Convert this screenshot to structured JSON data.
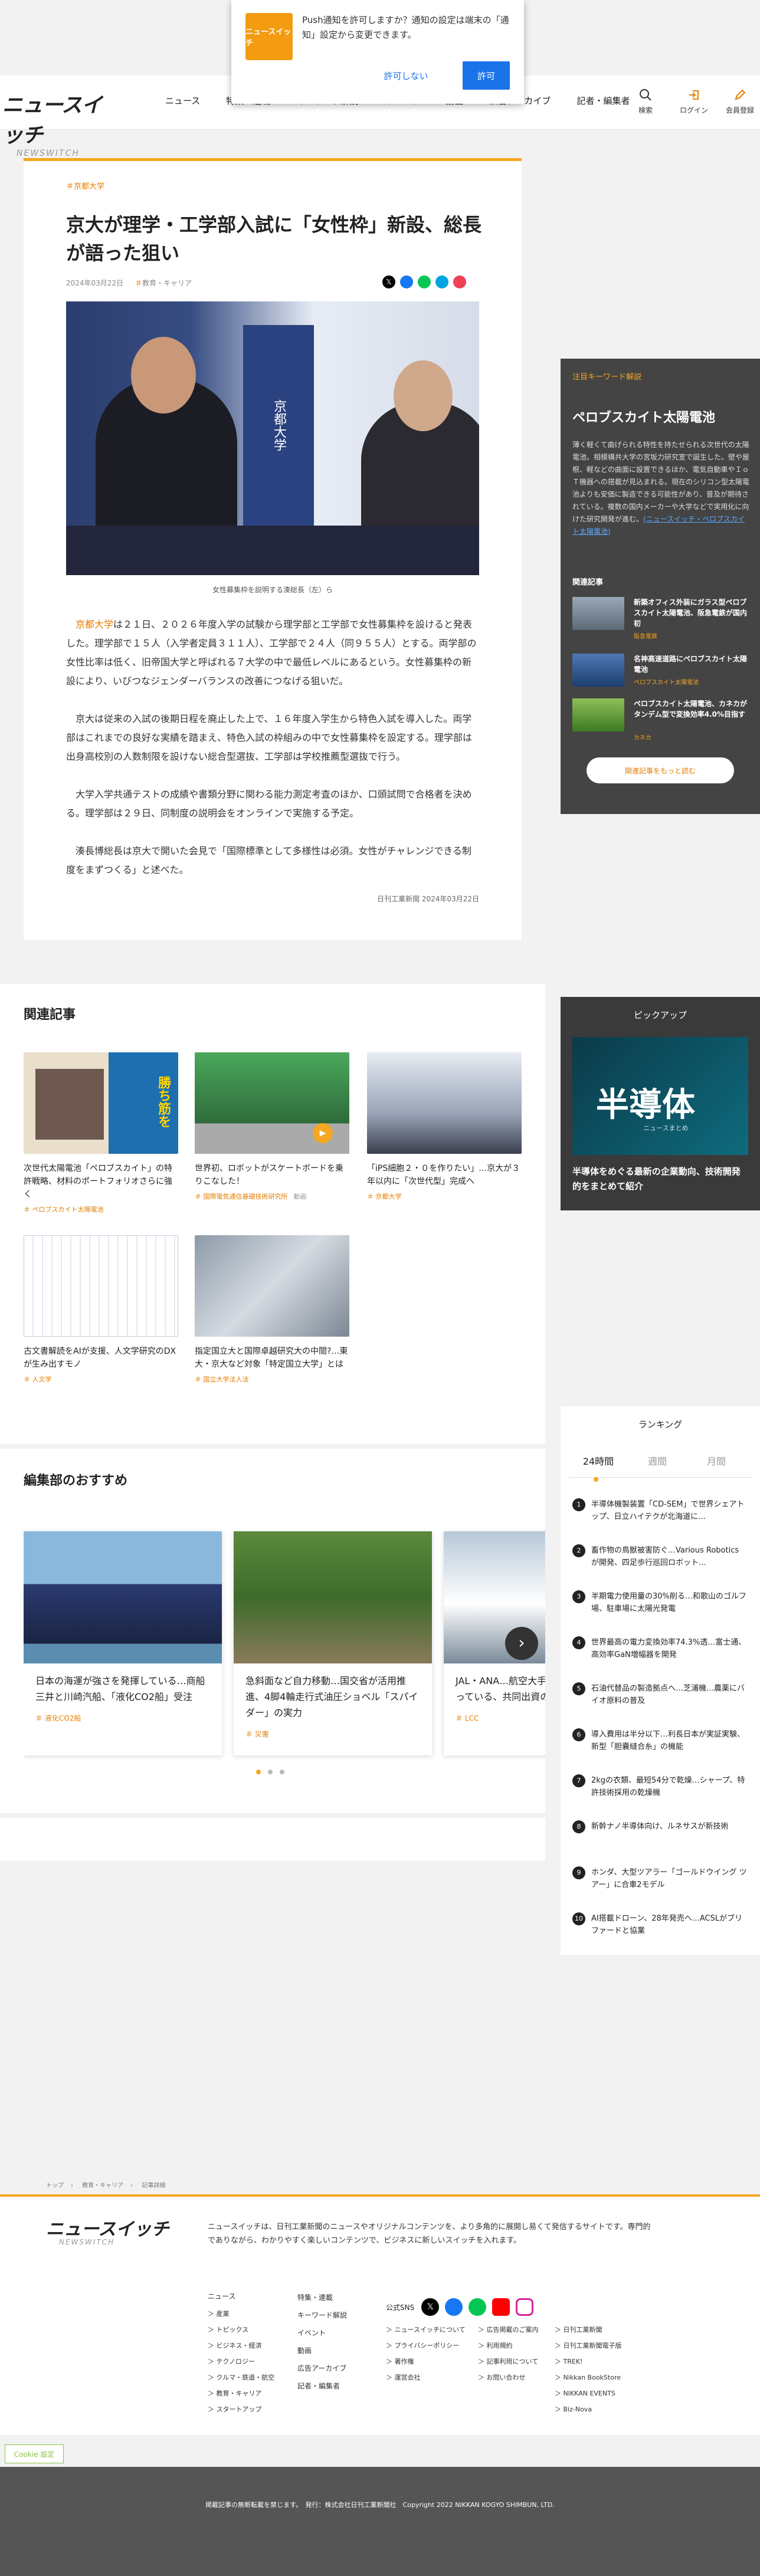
{
  "push": {
    "icon_text": "ニュースイッチ",
    "message": "Push通知を許可しますか？通知の設定は端末の「通知」設定から変更できます。",
    "deny": "許可しない",
    "allow": "許可"
  },
  "header": {
    "logo_main": "ニュースイッチ",
    "logo_sub": "NEWSWITCH",
    "nav": [
      "ニュース",
      "特集・連載",
      "キーワード解説",
      "イベント",
      "動画",
      "広告アーカイブ",
      "記者・編集者"
    ],
    "search": "検索",
    "login": "ログイン",
    "register": "会員登録"
  },
  "article": {
    "category": "京都大学",
    "title": "京大が理学・工学部入試に「女性枠」新設、総長が語った狙い",
    "date": "2024年03月22日",
    "section": "教育・キャリア",
    "photo_text": "京都大学",
    "caption": "女性募集枠を説明する湊総長（左）ら",
    "p1_link": "京都大学",
    "p1": "は２１日、２０２６年度入学の試験から理学部と工学部で女性募集枠を設けると発表した。理学部で１５人（入学者定員３１１人）、工学部で２４人（同９５５人）とする。両学部の女性比率は低く、旧帝国大学と呼ばれる７大学の中で最低レベルにあるという。女性募集枠の新設により、いびつなジェンダーバランスの改善につなげる狙いだ。",
    "p2": "京大は従来の入試の後期日程を廃止した上で、１６年度入学生から特色入試を導入した。両学部はこれまでの良好な実績を踏まえ、特色入試の枠組みの中で女性募集枠を設定する。理学部は出身高校別の人数制限を設けない総合型選抜、工学部は学校推薦型選抜で行う。",
    "p3": "大学入学共通テストの成績や書類分野に関わる能力測定考査のほか、口頭試問で合格者を決める。理学部は２９日、同制度の説明会をオンラインで実施する予定。",
    "p4": "湊長博総長は京大で開いた会見で「国際標準として多様性は必須。女性がチャレンジできる制度をまずつくる」と述べた。",
    "signature": "日刊工業新聞 2024年03月22日"
  },
  "keyword": {
    "label": "注目キーワード解説",
    "title": "ペロブスカイト太陽電池",
    "desc": "薄く軽くて曲げられる特性を持たせられる次世代の太陽電池。相模構共大学の宮坂力研究室で誕生した。壁や屋根、軽などの曲面に設置できるほか、電気自動車やＩｏＴ機器への搭載が見込まれる。現在のシリコン型太陽電池よりも安価に製造できる可能性があり、普及が期待されている。複数の国内メーカーや大学などで実用化に向けた研究開発が進む。",
    "desc_link": "(ニュースイッチ・ペロブスカイト太陽電池)",
    "related_label": "関連記事",
    "items": [
      {
        "t": "新築オフィス外装にガラス型ペロブスカイト太陽電池、阪急電鉄が国内初",
        "tag": "阪急電鉄"
      },
      {
        "t": "名神高速道路にペロブスカイト太陽電池",
        "tag": "ペロブスカイト太陽電池"
      },
      {
        "t": "ペロブスカイト太陽電池、カネカがタンデム型で変換効率4.0%目指す",
        "tag": "カネカ"
      }
    ],
    "more": "関連記事をもっと読む"
  },
  "pickup": {
    "label": "ピックアップ",
    "img_text": "半導体",
    "img_sub": "ニュースまとめ",
    "title": "半導体をめぐる最新の企業動向、技術開発的をまとめて紹介"
  },
  "related": {
    "heading": "関連記事",
    "items": [
      {
        "t": "次世代太陽電池「ペロブスカイト」の特許戦略、材料のポートフォリオさらに強く",
        "tag": "ペロブスカイト太陽電池",
        "img_text": "勝ち筋を"
      },
      {
        "t": "世界初、ロボットがスケートボードを乗りこなした！",
        "tag": "国際電気通信基礎技術研究所",
        "tag2": "動画"
      },
      {
        "t": "「iPS細胞２・０を作りたい」…京大が３年以内に「次世代型」完成へ",
        "tag": "京都大学"
      },
      {
        "t": "古文書解読をAIが支援、人文学研究のDXが生み出すモノ",
        "tag": "人文学"
      },
      {
        "t": "指定国立大と国際卓越研究大の中間?…東大・京大など対象「特定国立大学」とは",
        "tag": "国立大学法人法"
      }
    ]
  },
  "recos": {
    "heading": "編集部のおすすめ",
    "items": [
      {
        "t": "日本の海運が強さを発揮している…商船三井と川崎汽船、「液化CO2船」受注",
        "tag": "液化CO2船"
      },
      {
        "t": "急斜面など自力移動…国交省が活用推進、4脚4輪走行式油圧ショベル「スパイダー」の実力",
        "tag": "災害"
      },
      {
        "t": "JAL・ANA…航空大手が新たな事業に立っている、共同出資の…",
        "tag": "LCC"
      }
    ]
  },
  "ranking": {
    "title": "ランキング",
    "tabs": [
      "24時間",
      "週間",
      "月間"
    ],
    "items": [
      "半導体機製装置「CD-SEM」で世界シェアトップ、日立ハイテクが北海道に…",
      "畜作物の鳥獣被害防ぐ…Various Robotics が開発、四足歩行巡回ロボット…",
      "半期電力使用量の30%削る…和歌山のゴルフ場、駐車場に太陽光発電",
      "世界最高の電力変換効率74.3%透…富士通、高効率GaN増幅器を開発",
      "石油代替品の製造拠点へ…芝浦機…農薬にバイオ原料の普及",
      "導入費用は半分以下…利長日本が実証実験、新型「胆嚢縫合糸」の機能",
      "2kgの衣類、最短54分で乾燥…シャープ、特許技術採用の乾燥機",
      "新幹ナノ半導体向け、ルネサスが新技術",
      "ホンダ、大型ツアラー「ゴールドウイング ツアー」に合車2モデル",
      "AI搭載ドローン、28年発売へ…ACSLがブリファードと協業"
    ]
  },
  "breadcrumb": [
    "トップ",
    "教育・キャリア",
    "記事詳細"
  ],
  "footer": {
    "logo_main": "ニュースイッチ",
    "logo_sub": "NEWSWITCH",
    "desc": "ニュースイッチは、日刊工業新聞のニュースやオリジナルコンテンツを、より多角的に展開し易くて発信するサイトです。専門的でありながら、わかりやすく楽しいコンテンツで、ビジネスに新しいスイッチを入れます。",
    "col1_head": "ニュース",
    "col1": [
      "産業",
      "トピックス",
      "ビジネス・経済",
      "テクノロジー",
      "クルマ・鉄道・航空",
      "教育・キャリア",
      "スタートアップ"
    ],
    "col2": [
      "特集・連載",
      "キーワード解説",
      "イベント",
      "動画",
      "広告アーカイブ",
      "記者・編集者"
    ],
    "sns": "公式SNS",
    "col3": [
      "ニュースイッチについて",
      "プライバシーポリシー",
      "著作権",
      "運営会社"
    ],
    "col4": [
      "広告掲載のご案内",
      "利用規約",
      "記事利用について",
      "お問い合わせ"
    ],
    "col5": [
      "日刊工業新聞",
      "日刊工業新聞電子版",
      "TREK!",
      "Nikkan BookStore",
      "NIKKAN EVENTS",
      "Biz-Nova"
    ],
    "cookie": "Cookie 設定",
    "copyright": "掲載記事の無断転載を禁じます。　発行：株式会社日刊工業新聞社　Copyright 2022 NIKKAN KOGYO SHIMBUN, LTD."
  }
}
